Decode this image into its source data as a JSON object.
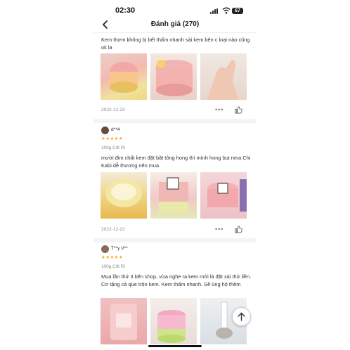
{
  "status_bar": {
    "time": "02:30",
    "battery": "67"
  },
  "header": {
    "title": "Đánh giá (270)"
  },
  "reviews": [
    {
      "text": "Kem thơm không bị bết  thấm nhanh sài kem bên c loại nào cũng ok la",
      "date": "2022-12-24",
      "more": "•••"
    },
    {
      "username": "d**4",
      "stars": "★★★★★",
      "variant": "100g Cốt Rì",
      "text": "mười đim chất kem đặt bặt tông hong thì mình hong bụt nma Chị Kabi dễ thương nên mua",
      "date": "2022-12-22",
      "more": "•••"
    },
    {
      "username": "T**y V**",
      "stars": "★★★★★",
      "variant": "100g Cốt Rì",
      "text": "Mua lần thứ 3 bên shop, vừa nghe ra kem mới là đặt xài thử liền. Cơ tặng cả que trộn kem. Kem thấm nhanh. Sẽ ủng hộ thêm"
    }
  ],
  "colors": {
    "star": "#f5a623",
    "text_muted": "#8a8a8a",
    "separator": "#f4f4f4"
  }
}
